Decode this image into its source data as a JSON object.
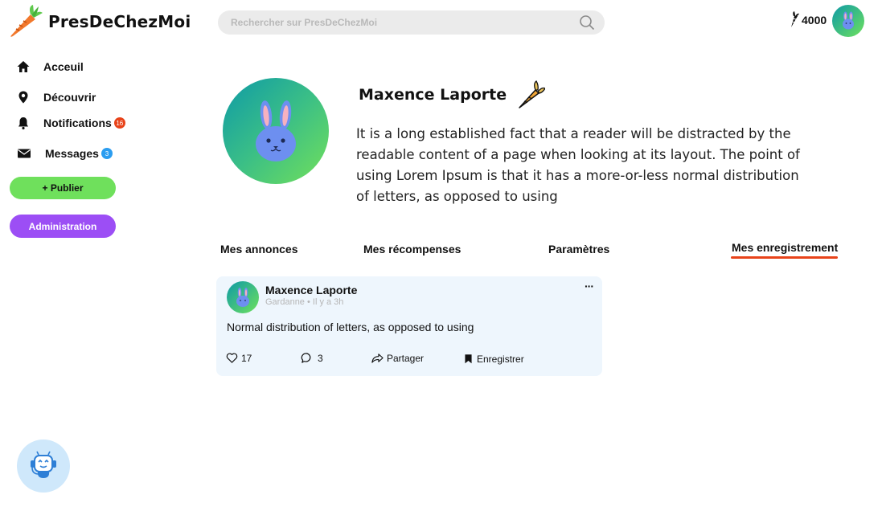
{
  "brand": {
    "name": "PresDeChezMoi"
  },
  "search": {
    "placeholder": "Rechercher sur PresDeChezMoi"
  },
  "wallet": {
    "balance": "4000"
  },
  "sidebar": {
    "items": [
      {
        "label": "Acceuil",
        "icon": "home-icon"
      },
      {
        "label": "Découvrir",
        "icon": "location-pin-icon"
      },
      {
        "label": "Notifications",
        "icon": "bell-icon",
        "badge": "16"
      },
      {
        "label": "Messages",
        "icon": "envelope-icon",
        "badge": "3"
      }
    ],
    "publish_label": "+ Publier",
    "admin_label": "Administration"
  },
  "profile": {
    "name": "Maxence Laporte",
    "bio": "It is a long established fact that a reader will be distracted by the readable content of a page when looking at its layout. The point of using Lorem Ipsum is that it has a more-or-less normal distribution of letters, as opposed to using"
  },
  "tabs": [
    {
      "label": "Mes annonces",
      "active": false
    },
    {
      "label": "Mes récompenses",
      "active": false
    },
    {
      "label": "Paramètres",
      "active": false
    },
    {
      "label": "Mes enregistrement",
      "active": true
    }
  ],
  "post": {
    "author": "Maxence Laporte",
    "location": "Gardanne",
    "time": "Il y a 3h",
    "meta": "Gardanne • Il y a 3h",
    "more": "···",
    "text": "Normal distribution of letters, as opposed to using",
    "likes": "17",
    "comments": "3",
    "share_label": "Partager",
    "save_label": "Enregistrer"
  },
  "colors": {
    "accent_green": "#6fe05c",
    "accent_purple": "#9c4ef5",
    "accent_orange": "#e8431a",
    "card_bg": "#eef6fd"
  }
}
